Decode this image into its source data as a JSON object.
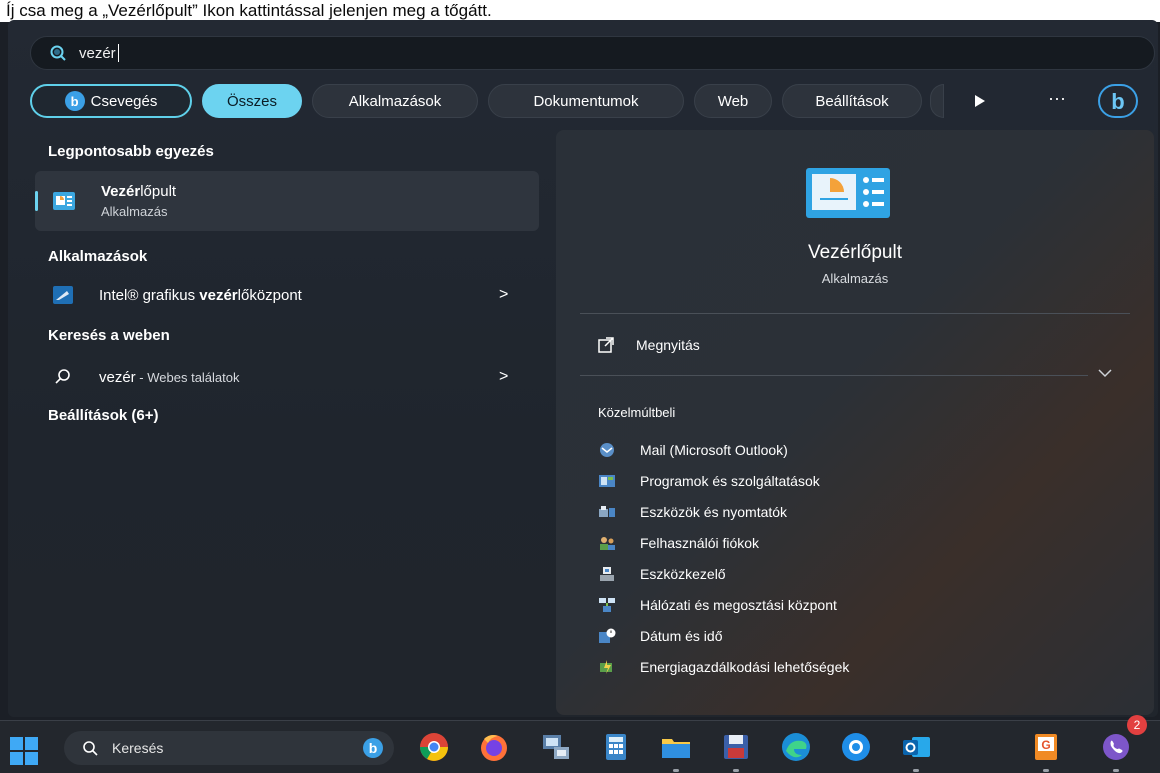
{
  "header_strip": {
    "text": "Íj csa meg a „Vezérlőpult” Ikon kattintással jelenjen meg a tőgátt."
  },
  "search": {
    "query": "vezér"
  },
  "filters": {
    "chat": "Csevegés",
    "all": "Összes",
    "apps": "Alkalmazások",
    "documents": "Dokumentumok",
    "web": "Web",
    "settings": "Beállítások",
    "more": "···"
  },
  "left": {
    "best_match_header": "Legpontosabb egyezés",
    "best_match": {
      "title_bold": "Vezér",
      "title_rest": "lőpult",
      "subtitle": "Alkalmazás"
    },
    "apps_header": "Alkalmazások",
    "app_item": {
      "pre": "Intel® grafikus ",
      "bold": "vezér",
      "post": "lőközpont",
      "chevron": ">"
    },
    "web_header": "Keresés a weben",
    "web_item": {
      "query": "vezér",
      "suffix": " - Webes találatok",
      "chevron": ">"
    },
    "settings_header": "Beállítások (6+)"
  },
  "right": {
    "app_name": "Vezérlőpult",
    "app_type": "Alkalmazás",
    "open_label": "Megnyitás",
    "recent_header": "Közelmúltbeli",
    "recent": [
      {
        "label": "Mail (Microsoft Outlook)",
        "icon": "mail-icon"
      },
      {
        "label": "Programok és szolgáltatások",
        "icon": "programs-icon"
      },
      {
        "label": "Eszközök és nyomtatók",
        "icon": "printer-icon"
      },
      {
        "label": "Felhasználói fiókok",
        "icon": "users-icon"
      },
      {
        "label": "Eszközkezelő",
        "icon": "device-manager-icon"
      },
      {
        "label": "Hálózati és megosztási központ",
        "icon": "network-icon"
      },
      {
        "label": "Dátum és idő",
        "icon": "clock-icon"
      },
      {
        "label": "Energiagazdálkodási lehetőségek",
        "icon": "power-icon"
      }
    ]
  },
  "taskbar": {
    "search_placeholder": "Keresés",
    "viber_badge": "2",
    "apps": [
      "bing-icon",
      "chrome-icon",
      "firefox-icon",
      "network-tool-icon",
      "calculator-icon",
      "file-explorer-icon",
      "save-disk-icon",
      "edge-icon",
      "app-circle-icon",
      "outlook-icon",
      "pdf-app-icon",
      "viber-icon"
    ]
  },
  "colors": {
    "accent": "#6cd3f0",
    "panel": "#232933",
    "taskbar": "#23272d"
  }
}
